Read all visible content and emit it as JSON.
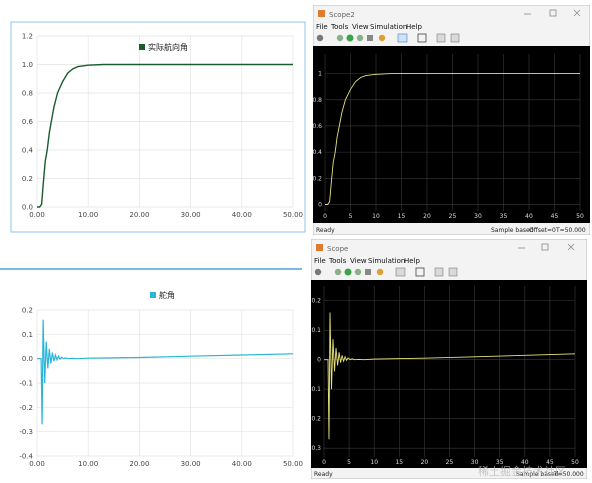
{
  "chart_data": [
    {
      "type": "line",
      "title": "",
      "legend": "实际航向角",
      "series": [
        {
          "name": "实际航向角",
          "x": [
            0,
            0.5,
            0.9,
            1.2,
            1.6,
            2.0,
            2.4,
            2.8,
            3.3,
            4.0,
            5.0,
            6.0,
            7.0,
            8.0,
            10.0,
            13.0,
            16.0,
            20.0,
            30.0,
            40.0,
            50.0
          ],
          "y": [
            0,
            0,
            0.02,
            0.15,
            0.32,
            0.4,
            0.52,
            0.6,
            0.7,
            0.8,
            0.88,
            0.94,
            0.97,
            0.985,
            0.995,
            1.0,
            1.0,
            1.0,
            1.0,
            1.0,
            1.0
          ]
        }
      ],
      "xlim": [
        0,
        50
      ],
      "ylim": [
        0,
        1.2
      ],
      "xticks": [
        "0.00",
        "10.00",
        "20.00",
        "30.00",
        "40.00",
        "50.00"
      ],
      "yticks": [
        "0.0",
        "0.2",
        "0.4",
        "0.6",
        "0.8",
        "1.0",
        "1.2"
      ],
      "color": "#1a5c2e"
    },
    {
      "type": "line",
      "title": "",
      "legend": "舵角",
      "series": [
        {
          "name": "舵角",
          "x": [
            0,
            0.8,
            1.0,
            1.2,
            1.5,
            1.8,
            2.1,
            2.4,
            2.7,
            3.0,
            3.3,
            3.6,
            3.9,
            4.2,
            4.5,
            4.8,
            5.2,
            5.6,
            6.0,
            7.0,
            8.0,
            10.0,
            20.0,
            30.0,
            40.0,
            50.0
          ],
          "y": [
            0,
            0,
            -0.27,
            0.16,
            -0.1,
            0.07,
            -0.04,
            0.04,
            -0.02,
            0.025,
            -0.01,
            0.015,
            -0.005,
            0.01,
            -0.002,
            0.006,
            0.0,
            0.003,
            0.0,
            0.001,
            0.0,
            0.002,
            0.005,
            0.01,
            0.015,
            0.02
          ]
        }
      ],
      "xlim": [
        0,
        50
      ],
      "ylim": [
        -0.4,
        0.2
      ],
      "xticks": [
        "0.00",
        "10.00",
        "20.00",
        "30.00",
        "40.00",
        "50.00"
      ],
      "yticks": [
        "-0.4",
        "-0.3",
        "-0.2",
        "-0.1",
        "0.0",
        "0.1",
        "0.2"
      ],
      "color": "#29b6d9"
    }
  ],
  "scope_windows": [
    {
      "title": "Scope2",
      "menu": [
        "File",
        "Tools",
        "View",
        "Simulation",
        "Help"
      ],
      "status_left": "Ready",
      "status_right": [
        "Sample based",
        "Offset=0",
        "T=50.000"
      ],
      "xticks": [
        "0",
        "5",
        "10",
        "15",
        "20",
        "25",
        "30",
        "35",
        "40",
        "45",
        "50"
      ],
      "yticks": [
        "1",
        "0.8",
        "0.6",
        "0.4",
        "0.2",
        "0"
      ],
      "trace_color": "#e8e27a"
    },
    {
      "title": "Scope",
      "menu": [
        "File",
        "Tools",
        "View",
        "Simulation",
        "Help"
      ],
      "status_left": "Ready",
      "status_right": [
        "Sample based",
        "T=50.000"
      ],
      "xticks": [
        "0",
        "5",
        "10",
        "15",
        "20",
        "25",
        "30",
        "35",
        "40",
        "45",
        "50"
      ],
      "yticks": [
        "0.2",
        "0.1",
        "0",
        "-0.1",
        "-0.2",
        "-0.3"
      ],
      "trace_color": "#e8e27a"
    }
  ],
  "watermark": "稀土掘金技术社区"
}
